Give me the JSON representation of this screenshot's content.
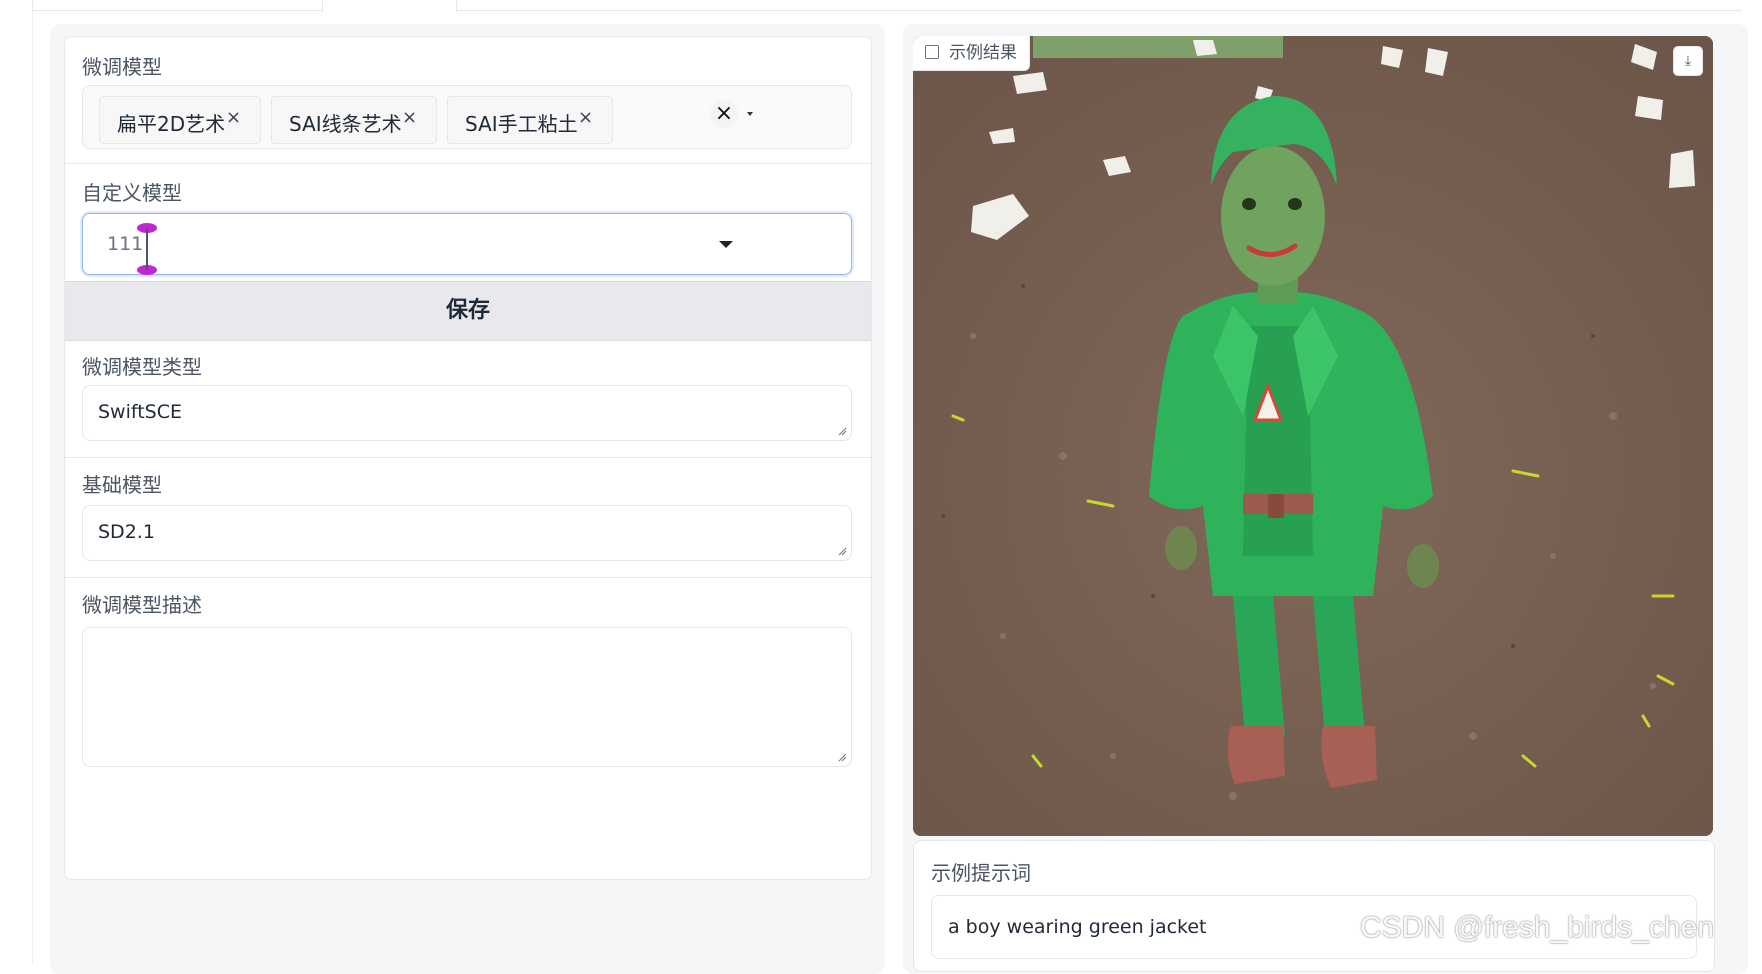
{
  "finetune": {
    "label": "微调模型",
    "chips": [
      {
        "label": "扁平2D艺术"
      },
      {
        "label": "SAI线条艺术"
      },
      {
        "label": "SAI手工粘土"
      }
    ],
    "chip_remove_glyph": "×",
    "clear_glyph": "×"
  },
  "custom_model": {
    "label": "自定义模型",
    "value": "111"
  },
  "save_button": "保存",
  "model_type": {
    "label": "微调模型类型",
    "value": "SwiftSCE"
  },
  "base_model": {
    "label": "基础模型",
    "value": "SD2.1"
  },
  "description": {
    "label": "微调模型描述",
    "value": ""
  },
  "example_result": {
    "label": "示例结果",
    "download_glyph": "⤓"
  },
  "example_prompt": {
    "label": "示例提示词",
    "value": "a boy wearing green jacket"
  },
  "watermark": "CSDN @fresh_birds_chen",
  "colors": {
    "focus_border": "#93b4f5",
    "save_bg": "#e8e9ec",
    "cursor_magenta": "#c026d3",
    "clay_green": "#2fb35a",
    "soil": "#7b6456"
  }
}
